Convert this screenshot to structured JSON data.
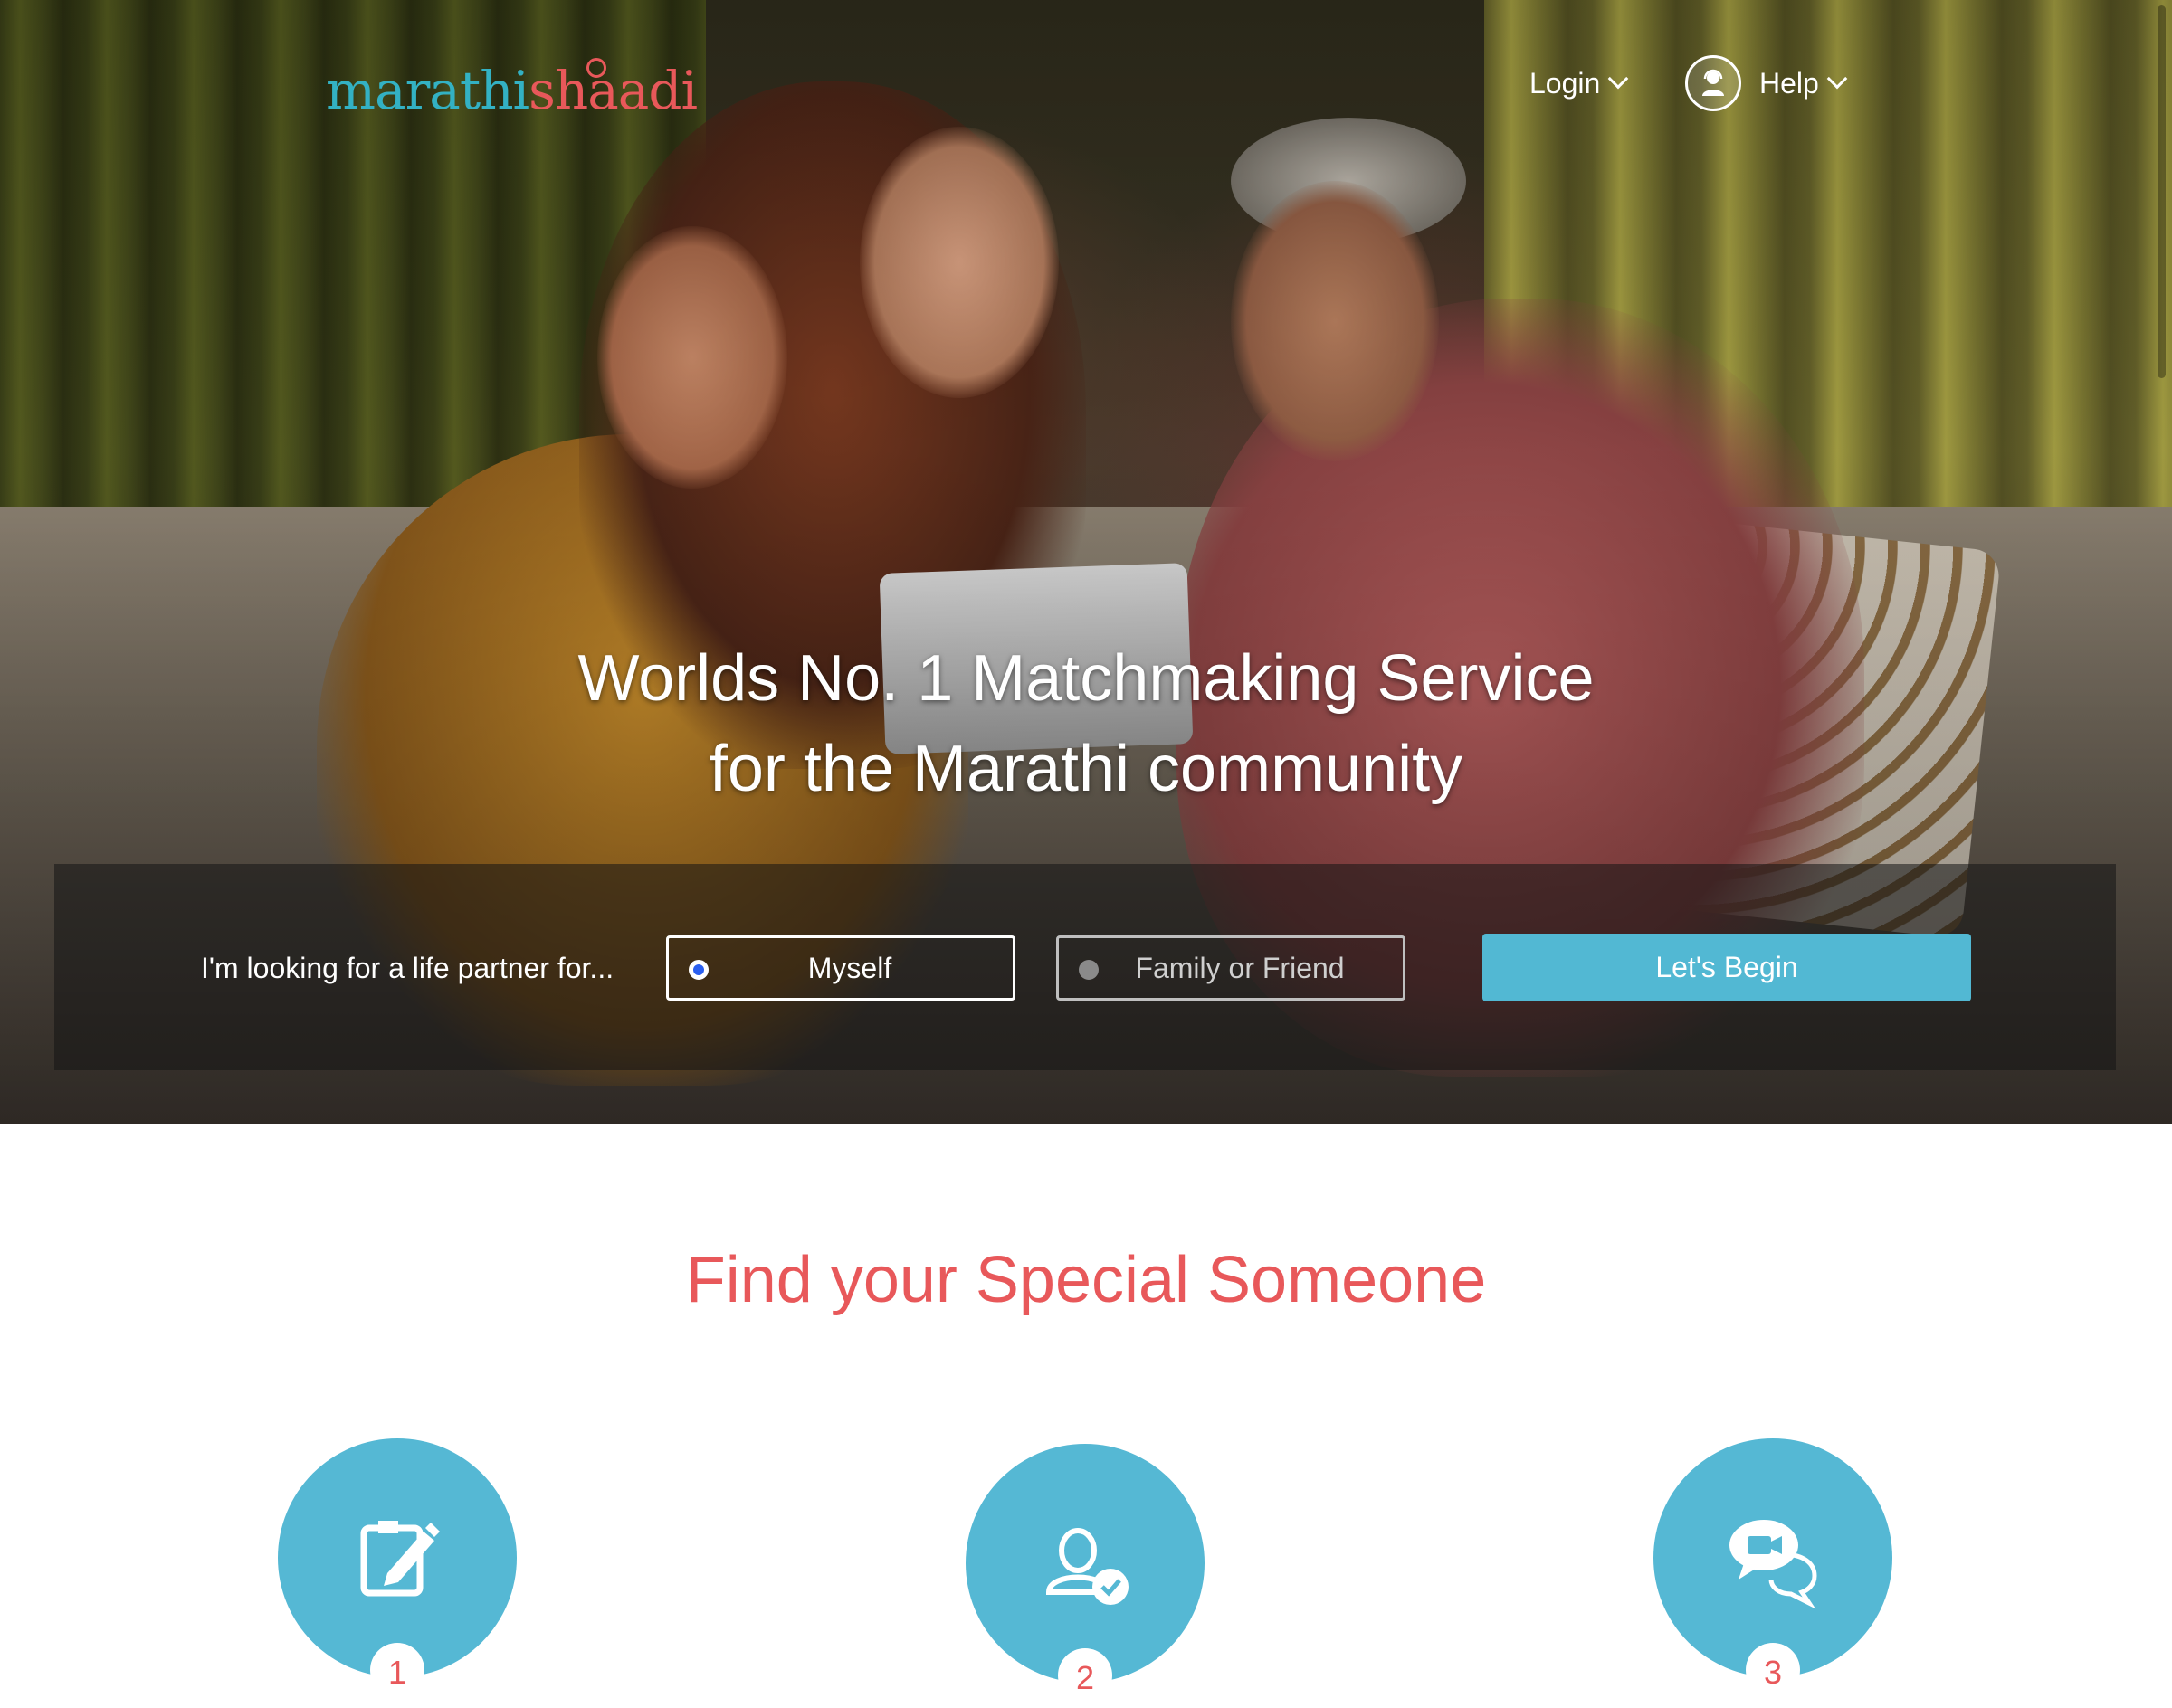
{
  "header": {
    "logo_part1": "marathi",
    "logo_part2": "shaadi",
    "login_label": "Login",
    "help_label": "Help"
  },
  "hero": {
    "title_line1": "Worlds No. 1 Matchmaking Service",
    "title_line2": "for the Marathi community"
  },
  "search": {
    "label": "I'm looking for a life partner for...",
    "options": [
      {
        "label": "Myself",
        "selected": true
      },
      {
        "label": "Family or Friend",
        "selected": false
      }
    ],
    "submit_label": "Let's Begin"
  },
  "features": {
    "title": "Find your Special Someone",
    "steps": [
      {
        "number": "1",
        "icon": "edit-profile-icon"
      },
      {
        "number": "2",
        "icon": "user-verified-icon"
      },
      {
        "number": "3",
        "icon": "chat-video-icon"
      }
    ]
  },
  "colors": {
    "brand_teal": "#33b1c3",
    "brand_coral": "#e8585a",
    "button_blue": "#52b8d3",
    "radio_blue": "#2a5ff0"
  }
}
